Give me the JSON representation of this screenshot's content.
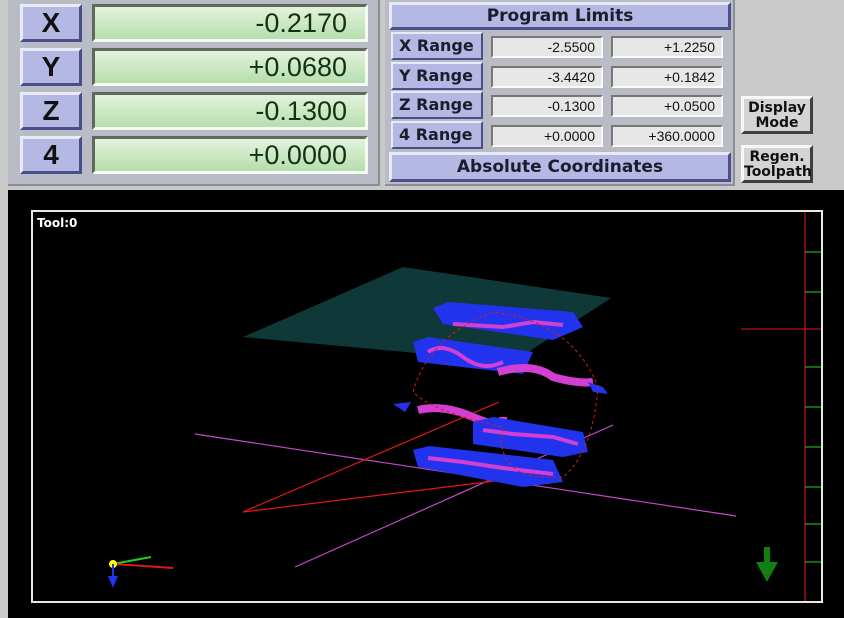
{
  "dro": {
    "axes": [
      {
        "label": "X",
        "value": "-0.2170"
      },
      {
        "label": "Y",
        "value": "+0.0680"
      },
      {
        "label": "Z",
        "value": "-0.1300"
      },
      {
        "label": "4",
        "value": "+0.0000"
      }
    ]
  },
  "limits": {
    "title": "Program Limits",
    "rows": [
      {
        "label": "X Range",
        "min": "-2.5500",
        "max": "+1.2250"
      },
      {
        "label": "Y Range",
        "min": "-3.4420",
        "max": "+0.1842"
      },
      {
        "label": "Z Range",
        "min": "-0.1300",
        "max": "+0.0500"
      },
      {
        "label": "4 Range",
        "min": "+0.0000",
        "max": "+360.0000"
      }
    ],
    "mode": "Absolute Coordinates"
  },
  "buttons": {
    "display_mode": "Display Mode",
    "regen_toolpath": "Regen. Toolpath"
  },
  "viewport": {
    "tool_label": "Tool:0"
  },
  "colors": {
    "dro_green": "#b7ddae",
    "button_blue": "#b4b8e2",
    "toolpath_blue": "#2233ee",
    "toolpath_magenta": "#d23fd2",
    "toolpath_red": "#e01818"
  }
}
